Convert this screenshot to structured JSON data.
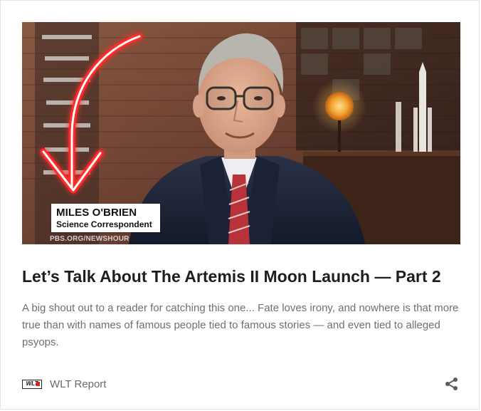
{
  "card": {
    "thumbnail": {
      "alt_icon": "video-thumbnail-image",
      "lower_third_name": "MILES O'BRIEN",
      "lower_third_role": "Science Correspondent",
      "watermark": "PBS.ORG/NEWSHOUR"
    },
    "title": "Let’s Talk About The Artemis II Moon Launch — Part 2",
    "excerpt": "A big shout out to a reader for catching this one... Fate loves irony, and nowhere is that more true than with names of famous people tied to famous stories — and even tied to alleged psyops.",
    "source": {
      "logo_text": "WLT",
      "name": "WLT Report"
    },
    "share_icon": "share-icon"
  },
  "colors": {
    "title": "#1e1e1e",
    "excerpt": "#6f6f6f",
    "source": "#6a6a6a",
    "arrow_glow": "#ff2a2a"
  }
}
